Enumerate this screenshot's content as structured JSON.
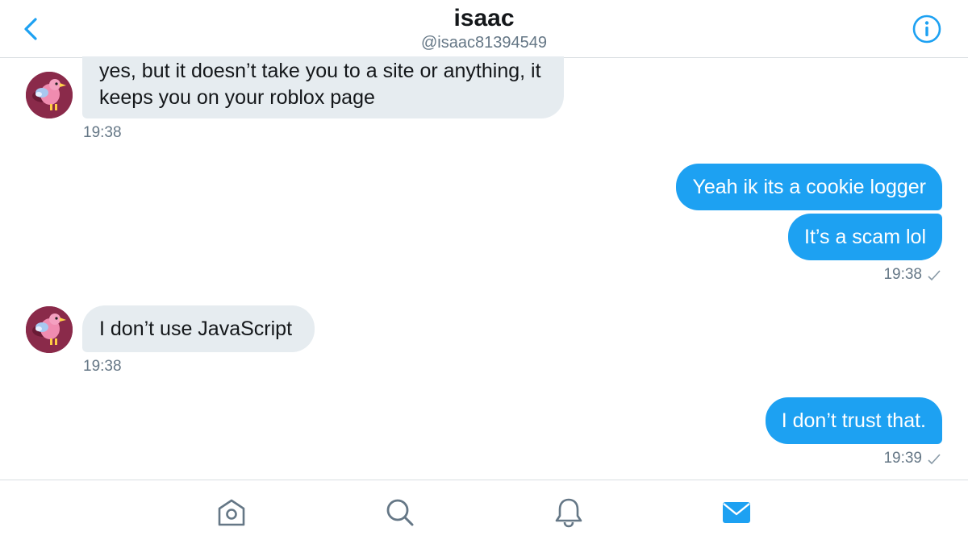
{
  "header": {
    "name": "isaac",
    "handle": "@isaac81394549"
  },
  "icons": {
    "back": "chevron-left-icon",
    "info": "info-circle-icon",
    "home": "home-icon",
    "search": "search-icon",
    "notifications": "bell-icon",
    "messages": "envelope-icon"
  },
  "messages": [
    {
      "direction": "in",
      "lines": [
        "yes, but it doesn’t take you to a site or anything, it",
        "keeps you on your roblox page"
      ]
    },
    {
      "direction": "in",
      "time": "19:38"
    },
    {
      "direction": "out",
      "text": "Yeah ik its a cookie logger"
    },
    {
      "direction": "out",
      "text": "It’s a scam lol"
    },
    {
      "direction": "out",
      "time": "19:38"
    },
    {
      "direction": "in",
      "text": "I don’t use JavaScript"
    },
    {
      "direction": "in",
      "time": "19:38"
    },
    {
      "direction": "out",
      "text": "I don’t trust that."
    },
    {
      "direction": "out",
      "time": "19:39"
    }
  ],
  "colors": {
    "accent": "#1da1f2",
    "incoming_bubble": "#e6ecf0",
    "secondary_text": "#657786",
    "divider": "#d9dee2"
  },
  "active_tab": "messages"
}
